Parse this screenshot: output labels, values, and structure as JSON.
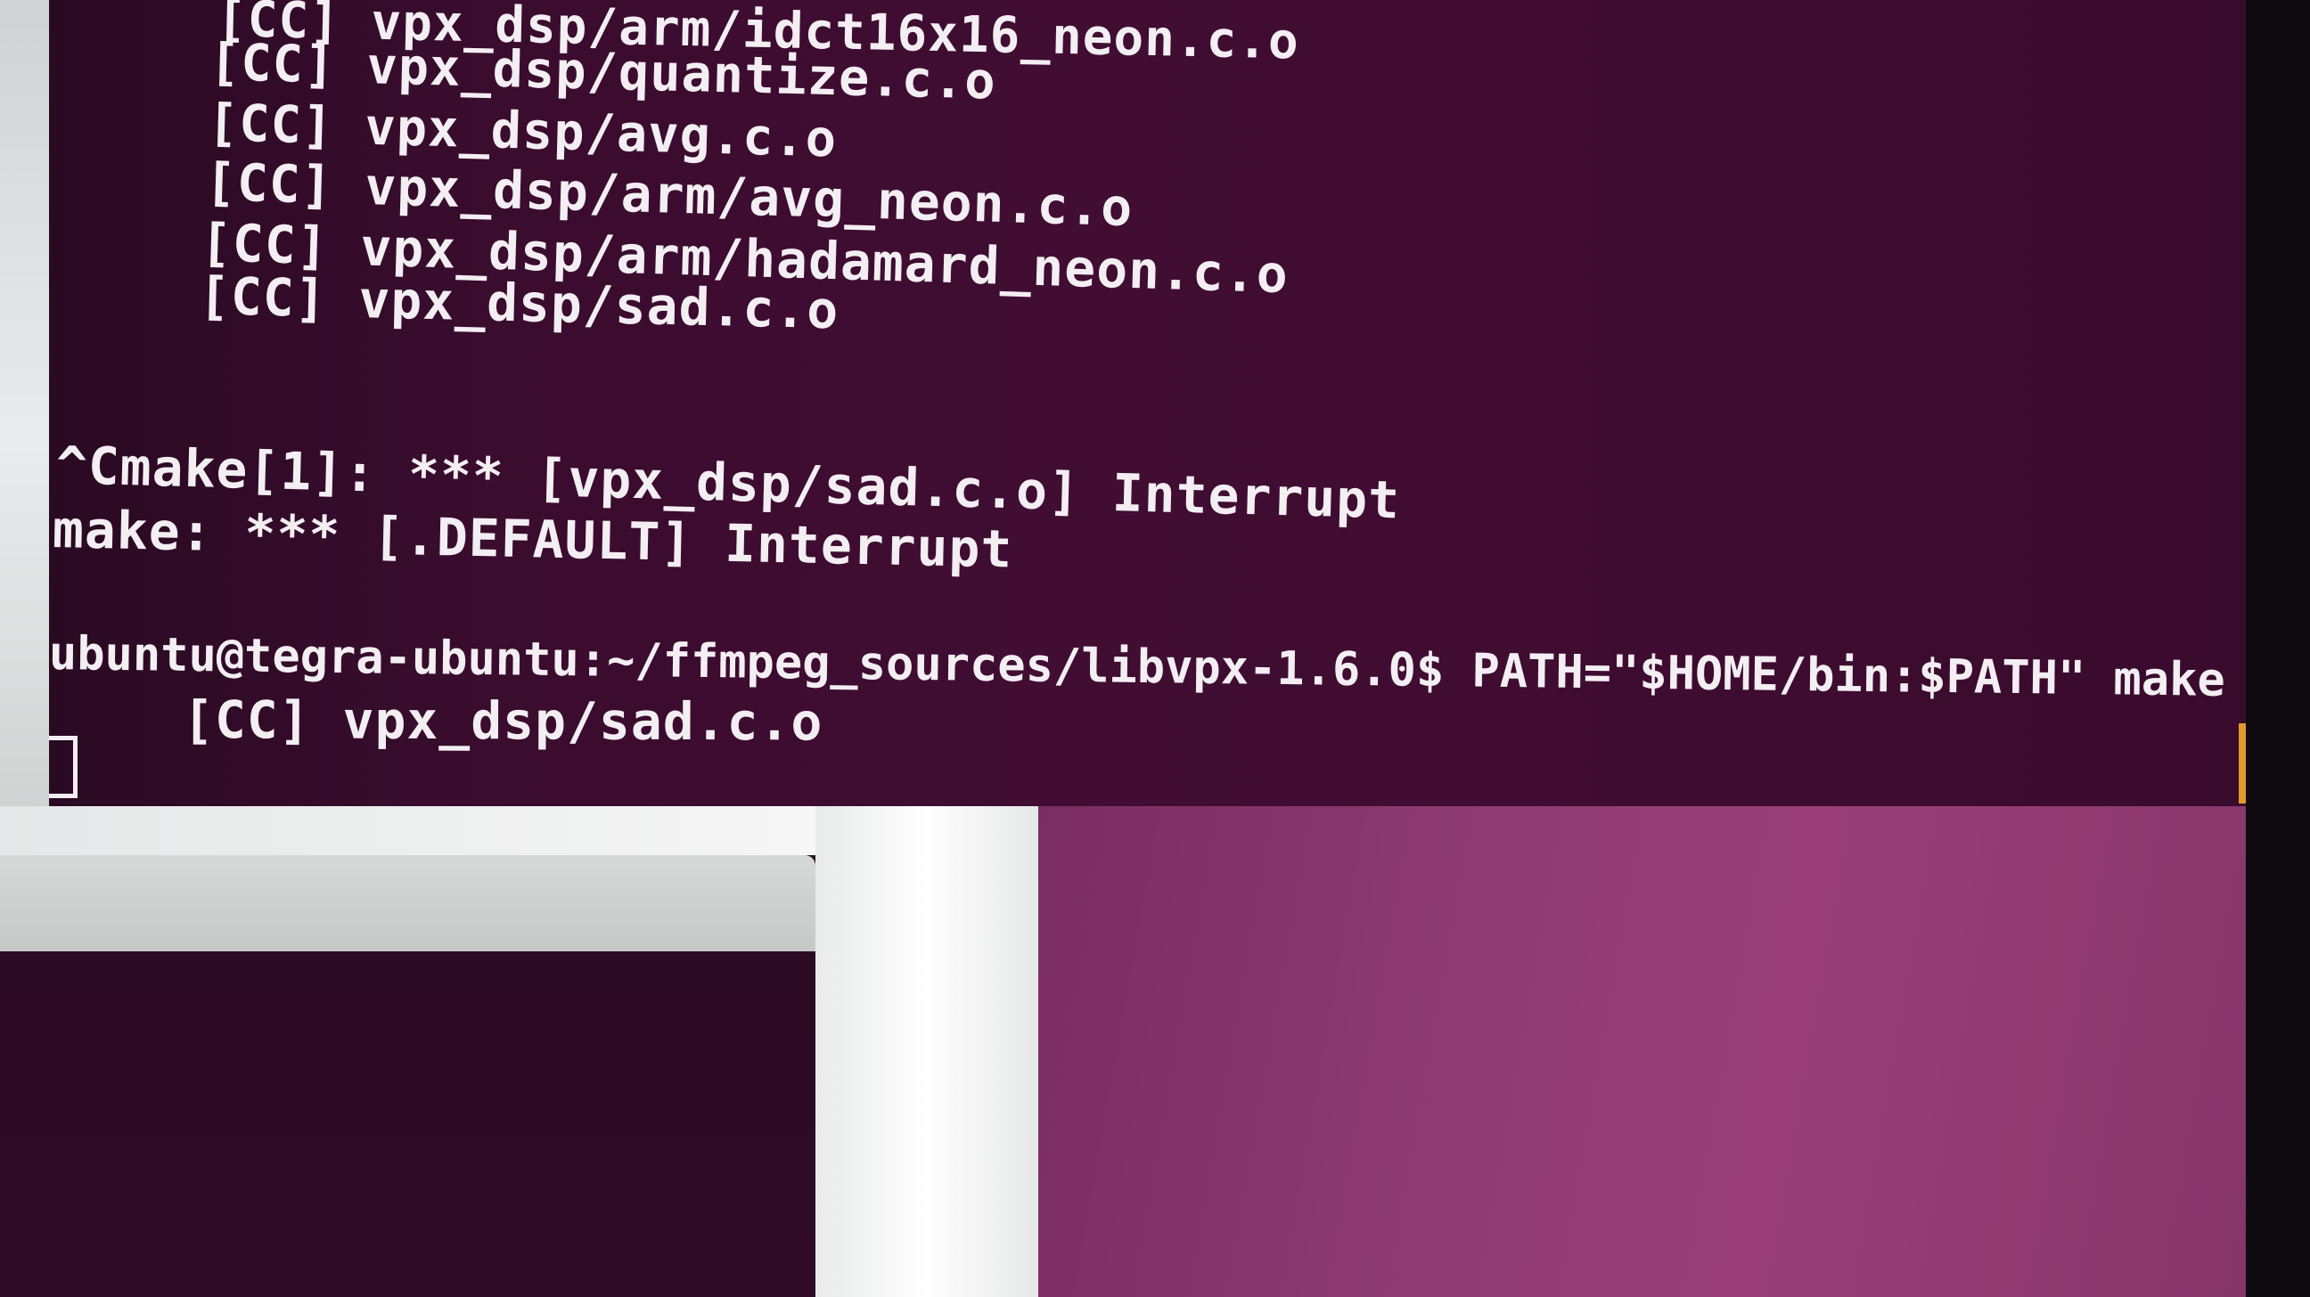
{
  "terminal": {
    "lines": [
      "[CC] vpx_dsp/arm/idct16x16_neon.c.o",
      "[CC] vpx_dsp/quantize.c.o",
      "[CC] vpx_dsp/avg.c.o",
      "[CC] vpx_dsp/arm/avg_neon.c.o",
      "[CC] vpx_dsp/arm/hadamard_neon.c.o",
      "[CC] vpx_dsp/sad.c.o",
      "^Cmake[1]: *** [vpx_dsp/sad.c.o] Interrupt",
      "make: *** [.DEFAULT] Interrupt",
      "ubuntu@tegra-ubuntu:~/ffmpeg_sources/libvpx-1.6.0$ PATH=\"$HOME/bin:$PATH\" make",
      "[CC] vpx_dsp/sad.c.o"
    ]
  },
  "colors": {
    "terminal_bg": "#3f0c31",
    "terminal_text": "#f3eef2",
    "desktop_bg": "#8e3b73",
    "scroll_indicator": "#e09a2c"
  },
  "icons": {
    "cursor": "block-cursor"
  }
}
